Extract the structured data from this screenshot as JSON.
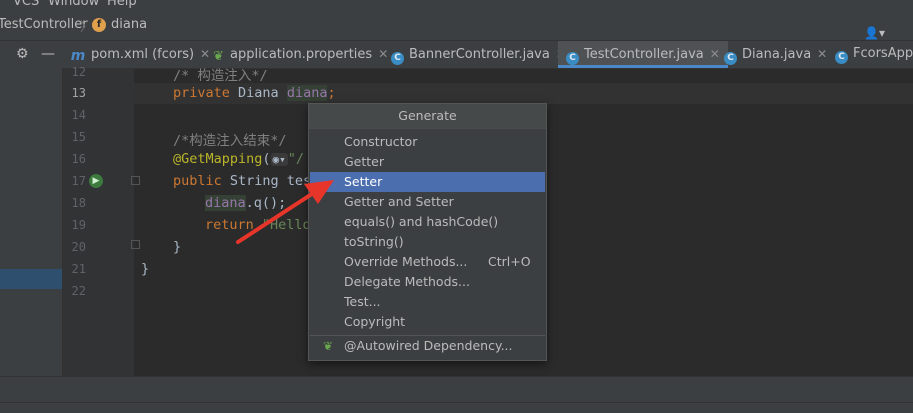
{
  "menubar": {
    "items": [
      "VCS",
      "Window",
      "Help"
    ]
  },
  "navbar": {
    "breadcrumb": [
      "TestController",
      "diana"
    ],
    "field_icon": "f"
  },
  "tabs": [
    {
      "label": "pom.xml (fcors)",
      "icon": "maven-icon",
      "active": false
    },
    {
      "label": "application.properties",
      "icon": "spring-leaf-icon",
      "active": false
    },
    {
      "label": "BannerController.java",
      "icon": "class-icon",
      "active": false
    },
    {
      "label": "TestController.java",
      "icon": "class-icon",
      "active": true
    },
    {
      "label": "Diana.java",
      "icon": "class-icon",
      "active": false
    },
    {
      "label": "FcorsAppli",
      "icon": "class-icon",
      "active": false
    }
  ],
  "editor": {
    "line_numbers": [
      "12",
      "13",
      "14",
      "15",
      "16",
      "17",
      "18",
      "19",
      "20",
      "21",
      "22"
    ],
    "current_line": "13",
    "lines": {
      "l12": "/* 构造注入*/",
      "l13_kw": "private ",
      "l13_type": "Diana ",
      "l13_field": "diana",
      "l13_end": ";",
      "l15": "/*构造注入结束*/",
      "l16_ann": "@GetMapping",
      "l16_rest": "(",
      "l16_str": "\"/",
      "l17_kw": "public ",
      "l17_rest": "String tes",
      "l18_field": "diana",
      "l18_rest": ".q();",
      "l19_kw": "return ",
      "l19_str": "\"Hello",
      "l20": "}",
      "l21": "}"
    }
  },
  "popup": {
    "title": "Generate",
    "items": [
      {
        "label": "Constructor",
        "shortcut": ""
      },
      {
        "label": "Getter",
        "shortcut": ""
      },
      {
        "label": "Setter",
        "shortcut": "",
        "selected": true
      },
      {
        "label": "Getter and Setter",
        "shortcut": ""
      },
      {
        "label": "equals() and hashCode()",
        "shortcut": ""
      },
      {
        "label": "toString()",
        "shortcut": ""
      },
      {
        "label": "Override Methods...",
        "shortcut": "Ctrl+O"
      },
      {
        "label": "Delegate Methods...",
        "shortcut": ""
      },
      {
        "label": "Test...",
        "shortcut": ""
      },
      {
        "label": "Copyright",
        "shortcut": ""
      }
    ],
    "footer_item": "@Autowired Dependency..."
  },
  "colors": {
    "selection": "#4b6eaf",
    "annotation_arrow": "#e8352a",
    "background": "#2b2b2b"
  }
}
